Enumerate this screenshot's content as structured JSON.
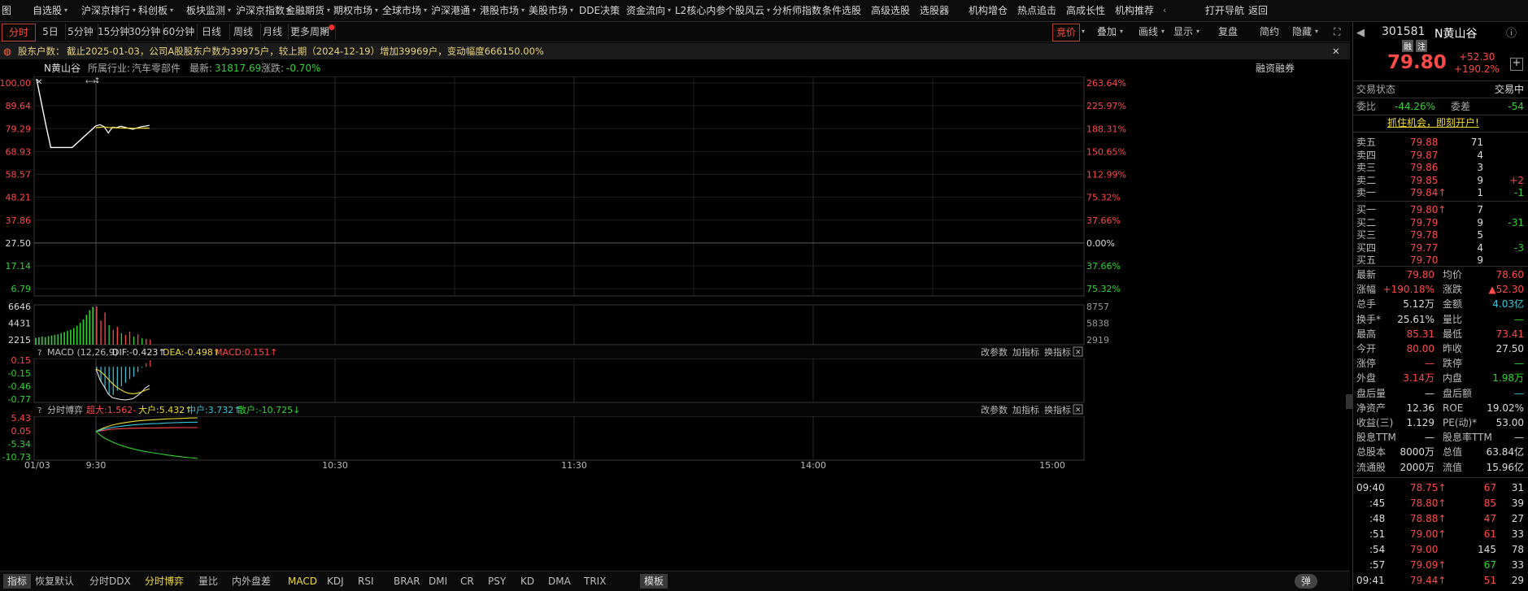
{
  "topnav": {
    "items": [
      "图",
      "自选股",
      "沪深京排行",
      "科创板",
      "板块监测",
      "沪深京指数",
      "金融期货",
      "期权市场",
      "全球市场",
      "沪深港通",
      "港股市场",
      "美股市场",
      "DDE决策",
      "资金流向",
      "L2核心内参",
      "个股风云",
      "分析师指数",
      "条件选股",
      "高级选股",
      "选股器",
      "机构增仓",
      "热点追击",
      "高成长性",
      "机构推荐",
      "打开导航",
      "返回"
    ]
  },
  "periods": [
    "分时",
    "5日",
    "5分钟",
    "15分钟",
    "30分钟",
    "60分钟",
    "日线",
    "周线",
    "月线",
    "更多周期"
  ],
  "tools": [
    "竞价",
    "叠加",
    "画线",
    "显示",
    "复盘",
    "简约",
    "隐藏"
  ],
  "notice": {
    "title": "股东户数：",
    "text": "截止2025-01-03，公司A股股东户数为39975户，较上期（2024-12-19）增加39969户，变动幅度666150.00%",
    "close": "✕"
  },
  "infobar": {
    "name": "N黄山谷",
    "industry_label": "所属行业:",
    "industry": "汽车零部件",
    "latest_label": "最新:",
    "latest": "31817.69",
    "change_label": "涨跌:",
    "change": "-0.70%",
    "margin": "融资融券"
  },
  "chart_data": [
    {
      "type": "line",
      "title": "",
      "x_ticks": [
        "9:30",
        "10:30",
        "11:30",
        "14:00",
        "15:00"
      ],
      "x_label_left": "01/03",
      "y_ticks_left": [
        "100.00",
        "89.64",
        "79.29",
        "68.93",
        "58.57",
        "48.21",
        "37.86",
        "27.50",
        "17.14",
        "6.79"
      ],
      "y_ticks_right": [
        "263.64%",
        "225.97%",
        "188.31%",
        "150.65%",
        "112.99%",
        "75.32%",
        "37.66%",
        "0.00%",
        "37.66%",
        "75.32%"
      ],
      "prev_close": 27.5,
      "ylim": [
        6.79,
        100.0
      ],
      "series": [
        {
          "name": "",
          "color": "#ffffff",
          "x": [
            0,
            1,
            2,
            3,
            4,
            5,
            6,
            7,
            8,
            9,
            10,
            11,
            12,
            13
          ],
          "values": [
            79.6,
            80.1,
            79.2,
            76.5,
            79.0,
            78.8,
            79.4,
            79.0,
            78.5,
            78.1,
            78.7,
            79.2,
            79.5,
            79.8
          ]
        },
        {
          "name": "",
          "color": "#f0dc32",
          "x": [
            0,
            1,
            2,
            3,
            4,
            5,
            6,
            7,
            8,
            9,
            10,
            11,
            12,
            13
          ],
          "values": [
            78.8,
            79.0,
            79.1,
            78.9,
            78.8,
            78.7,
            78.7,
            78.6,
            78.6,
            78.55,
            78.55,
            78.58,
            78.6,
            78.6
          ]
        }
      ],
      "pre_market": {
        "x": [
          -2.5,
          -2.1,
          -1.9,
          -1.0,
          0
        ],
        "values": [
          100.0,
          79.6,
          70.2,
          70.2,
          79.6
        ]
      }
    },
    {
      "type": "bar",
      "title": "",
      "y_ticks_left": [
        "6646",
        "4431",
        "2215"
      ],
      "y_ticks_right": [
        "8757",
        "5838",
        "2919"
      ],
      "ylim": [
        0,
        6646
      ],
      "pre_market_bars": [
        1200,
        1300,
        1400,
        1300,
        1500,
        1600,
        1700,
        1800,
        2000,
        2200,
        2400,
        2600,
        2900,
        3300,
        3800,
        4400,
        5200,
        6000,
        6600
      ],
      "bars": [
        6646,
        4200,
        5600,
        3400,
        2600,
        3100,
        2000,
        1700,
        2300,
        1400,
        1800,
        1100,
        1000,
        900
      ],
      "bar_colors": [
        "red",
        "red",
        "red",
        "green",
        "red",
        "red",
        "green",
        "red",
        "red",
        "green",
        "red",
        "green",
        "red",
        "red"
      ]
    },
    {
      "type": "line",
      "title": "MACD (12,26,9)",
      "dif_label": "DIF:-0.423↑",
      "dea_label": "DEA:-0.498↑",
      "macd_label": "MACD:0.151↑",
      "y_ticks_left": [
        "0.15",
        "-0.15",
        "-0.46",
        "-0.77"
      ],
      "ylim": [
        -0.77,
        0.15
      ],
      "dif": [
        -0.05,
        -0.3,
        -0.45,
        -0.62,
        -0.7,
        -0.72,
        -0.74,
        -0.75,
        -0.74,
        -0.72,
        -0.66,
        -0.58,
        -0.48,
        -0.42
      ],
      "dea": [
        -0.05,
        -0.1,
        -0.18,
        -0.28,
        -0.38,
        -0.46,
        -0.52,
        -0.57,
        -0.6,
        -0.61,
        -0.6,
        -0.57,
        -0.53,
        -0.5
      ],
      "macd": [
        -0.05,
        -0.35,
        -0.5,
        -0.62,
        -0.64,
        -0.54,
        -0.44,
        -0.36,
        -0.28,
        -0.22,
        -0.12,
        -0.02,
        0.08,
        0.15
      ]
    },
    {
      "type": "line",
      "title": "分时博弈",
      "labels": [
        "超大:1.562-",
        "大户:5.432↑",
        "中户:3.732↑",
        "散户:-10.725↓"
      ],
      "y_ticks_left": [
        "5.43",
        "0.05",
        "-5.34",
        "-10.73"
      ],
      "ylim": [
        -10.73,
        5.43
      ],
      "series": [
        {
          "name": "超大",
          "color": "#ff4a4a",
          "values": [
            0.0,
            0.5,
            0.9,
            1.1,
            1.2,
            1.3,
            1.35,
            1.4,
            1.45,
            1.5,
            1.52,
            1.54,
            1.56,
            1.562
          ]
        },
        {
          "name": "大户",
          "color": "#f0dc32",
          "values": [
            0.0,
            1.5,
            2.5,
            3.2,
            3.7,
            4.1,
            4.4,
            4.6,
            4.8,
            5.0,
            5.1,
            5.2,
            5.35,
            5.432
          ]
        },
        {
          "name": "中户",
          "color": "#32c8dc",
          "values": [
            0.0,
            1.0,
            1.6,
            2.0,
            2.4,
            2.7,
            2.9,
            3.1,
            3.2,
            3.4,
            3.5,
            3.6,
            3.7,
            3.732
          ]
        },
        {
          "name": "散户",
          "color": "#31d231",
          "values": [
            0.0,
            -2.5,
            -4.0,
            -5.3,
            -6.3,
            -7.1,
            -7.8,
            -8.3,
            -8.8,
            -9.3,
            -9.7,
            -10.1,
            -10.4,
            -10.725
          ]
        }
      ]
    }
  ],
  "panel_actions": [
    "改参数",
    "加指标",
    "换指标"
  ],
  "bottom_tabs": [
    "指标",
    "恢复默认",
    "分时DDX",
    "分时博弈",
    "量比",
    "内外盘差",
    "MACD",
    "KDJ",
    "RSI",
    "BRAR",
    "DMI",
    "CR",
    "PSY",
    "KD",
    "DMA",
    "TRIX",
    "模板"
  ],
  "bottom_toggle": "弹",
  "right": {
    "code": "301581",
    "name": "N黄山谷",
    "badges": [
      "融",
      "注"
    ],
    "price": "79.80",
    "change": "+52.30",
    "pct": "+190.2%",
    "status_label": "交易状态",
    "status": "交易中",
    "weibi_label": "委比",
    "weibi": "-44.26%",
    "weicha_label": "委差",
    "weicha": "-54",
    "promo": "抓住机会，即刻开户!",
    "asks": [
      {
        "label": "卖五",
        "price": "79.88",
        "vol": "71",
        "chg": ""
      },
      {
        "label": "卖四",
        "price": "79.87",
        "vol": "4",
        "chg": ""
      },
      {
        "label": "卖三",
        "price": "79.86",
        "vol": "3",
        "chg": ""
      },
      {
        "label": "卖二",
        "price": "79.85",
        "vol": "9",
        "chg": "+2"
      },
      {
        "label": "卖一",
        "price": "79.84↑",
        "vol": "1",
        "chg": "-1"
      }
    ],
    "bids": [
      {
        "label": "买一",
        "price": "79.80↑",
        "vol": "7",
        "chg": ""
      },
      {
        "label": "买二",
        "price": "79.79",
        "vol": "9",
        "chg": "-31"
      },
      {
        "label": "买三",
        "price": "79.78",
        "vol": "5",
        "chg": ""
      },
      {
        "label": "买四",
        "price": "79.77",
        "vol": "4",
        "chg": "-3"
      },
      {
        "label": "买五",
        "price": "79.70",
        "vol": "9",
        "chg": ""
      }
    ],
    "stats": [
      {
        "l1": "最新",
        "v1": "79.80",
        "c1": "red",
        "l2": "均价",
        "v2": "78.60",
        "c2": "red"
      },
      {
        "l1": "涨幅",
        "v1": "+190.18%",
        "c1": "red",
        "l2": "涨跌",
        "v2": "▲52.30",
        "c2": "red"
      },
      {
        "l1": "总手",
        "v1": "5.12万",
        "c1": "white",
        "l2": "金额",
        "v2": "4.03亿",
        "c2": "cyan"
      },
      {
        "l1": "换手*",
        "v1": "25.61%",
        "c1": "white",
        "l2": "量比",
        "v2": "—",
        "c2": "green"
      },
      {
        "l1": "最高",
        "v1": "85.31",
        "c1": "red",
        "l2": "最低",
        "v2": "73.41",
        "c2": "red"
      },
      {
        "l1": "今开",
        "v1": "80.00",
        "c1": "red",
        "l2": "昨收",
        "v2": "27.50",
        "c2": "white"
      },
      {
        "l1": "涨停",
        "v1": "—",
        "c1": "red",
        "l2": "跌停",
        "v2": "—",
        "c2": "green"
      },
      {
        "l1": "外盘",
        "v1": "3.14万",
        "c1": "red",
        "l2": "内盘",
        "v2": "1.98万",
        "c2": "green"
      },
      {
        "l1": "盘后量",
        "v1": "—",
        "c1": "white",
        "l2": "盘后额",
        "v2": "—",
        "c2": "cyan"
      },
      {
        "l1": "净资产",
        "v1": "12.36",
        "c1": "white",
        "l2": "ROE",
        "v2": "19.02%",
        "c2": "white"
      },
      {
        "l1": "收益(三)",
        "v1": "1.129",
        "c1": "white",
        "l2": "PE(动)*",
        "v2": "53.00",
        "c2": "white"
      },
      {
        "l1": "股息TTM",
        "v1": "—",
        "c1": "white",
        "l2": "股息率TTM",
        "v2": "—",
        "c2": "white"
      },
      {
        "l1": "总股本",
        "v1": "8000万",
        "c1": "white",
        "l2": "总值",
        "v2": "63.84亿",
        "c2": "white"
      },
      {
        "l1": "流通股",
        "v1": "2000万",
        "c1": "white",
        "l2": "流值",
        "v2": "15.96亿",
        "c2": "white"
      }
    ],
    "ticks": [
      {
        "t": "09:40",
        "p": "78.75↑",
        "pc": "red",
        "v": "67",
        "vc": "red",
        "n": "31"
      },
      {
        "t": ":45",
        "p": "78.80↑",
        "pc": "red",
        "v": "85",
        "vc": "red",
        "n": "39"
      },
      {
        "t": ":48",
        "p": "78.88↑",
        "pc": "red",
        "v": "47",
        "vc": "red",
        "n": "27"
      },
      {
        "t": ":51",
        "p": "79.00↑",
        "pc": "red",
        "v": "61",
        "vc": "red",
        "n": "33"
      },
      {
        "t": ":54",
        "p": "79.00",
        "pc": "red",
        "v": "145",
        "vc": "white",
        "n": "78"
      },
      {
        "t": ":57",
        "p": "79.09↑",
        "pc": "red",
        "v": "67",
        "vc": "green",
        "n": "33"
      },
      {
        "t": "09:41",
        "p": "79.44↑",
        "pc": "red",
        "v": "51",
        "vc": "red",
        "n": "29"
      }
    ]
  }
}
